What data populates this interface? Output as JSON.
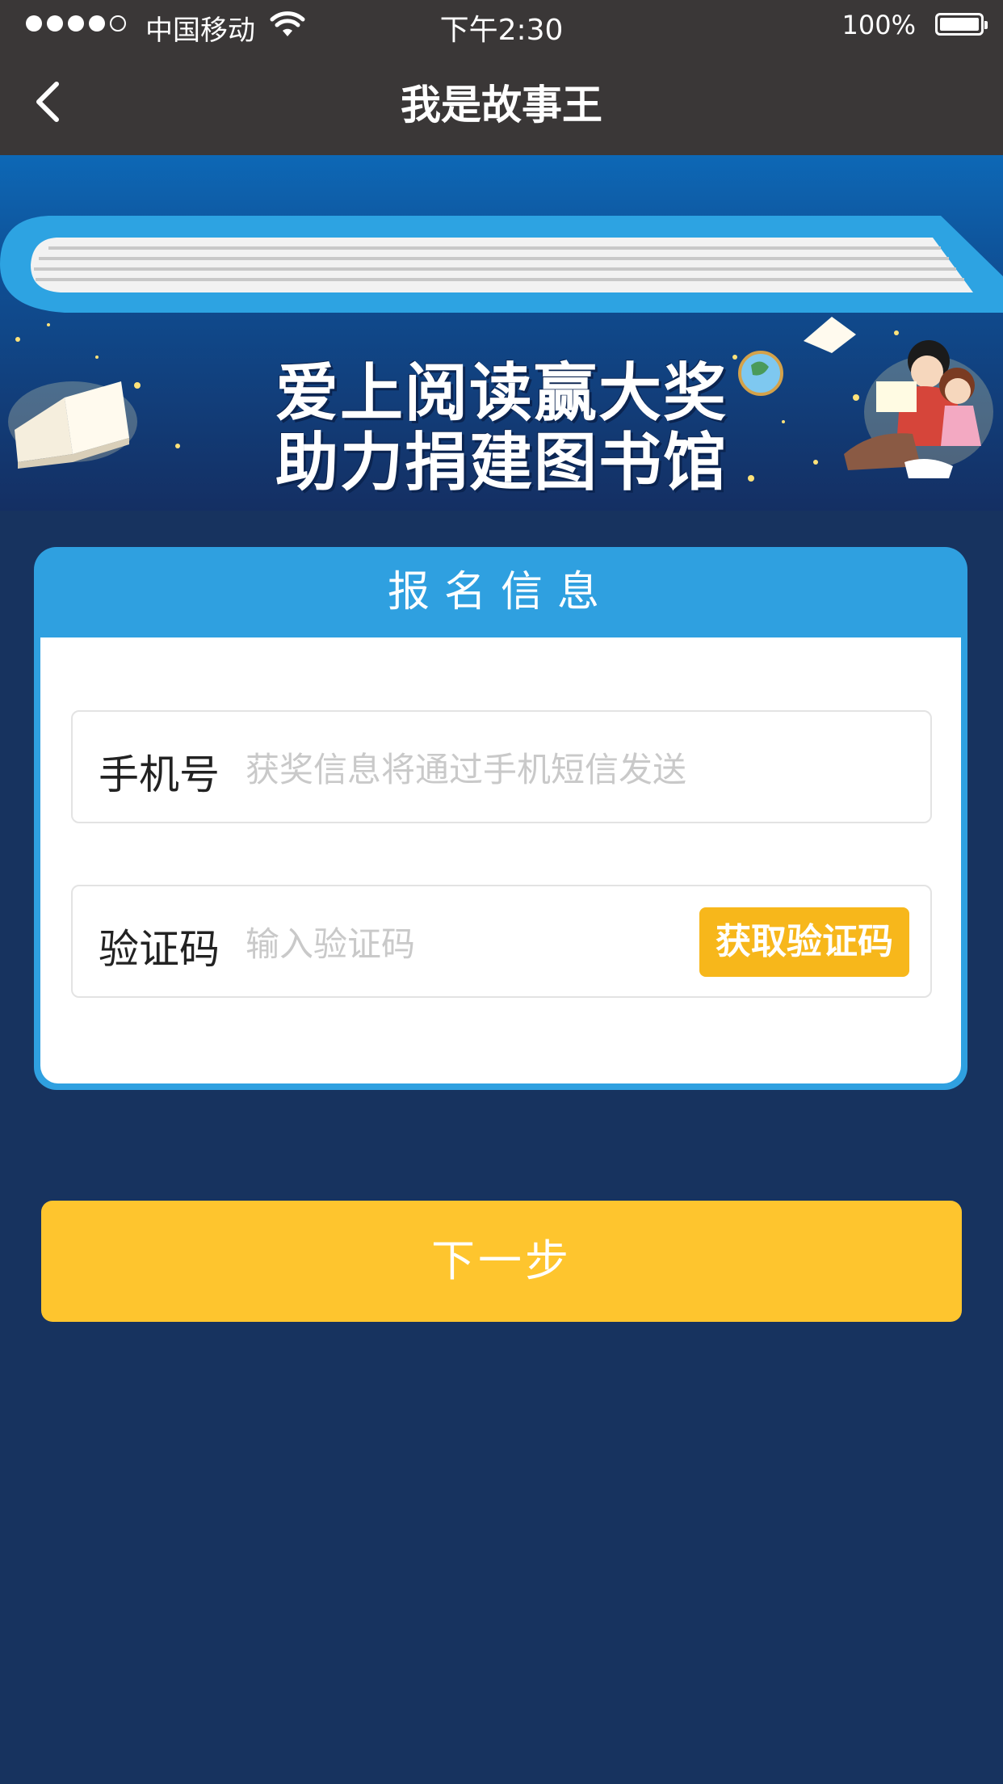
{
  "status_bar": {
    "carrier": "中国移动",
    "time": "下午2:30",
    "battery": "100%",
    "signal_icon": "signal-dots-icon",
    "wifi_icon": "wifi-icon",
    "battery_icon": "battery-icon"
  },
  "nav": {
    "title": "我是故事王",
    "back_icon": "chevron-left-icon"
  },
  "banner": {
    "line1": "爱上阅读赢大奖",
    "line2": "助力捐建图书馆"
  },
  "form": {
    "title": "报名信息",
    "phone": {
      "label": "手机号",
      "placeholder": "获奖信息将通过手机短信发送",
      "value": ""
    },
    "code": {
      "label": "验证码",
      "placeholder": "输入验证码",
      "value": "",
      "button_label": "获取验证码"
    }
  },
  "next_button": "下一步",
  "colors": {
    "status_bar": "#3a3737",
    "background": "#17335f",
    "card_header": "#2fa0e0",
    "code_button": "#f7b71b",
    "next_button": "#fec52e"
  }
}
